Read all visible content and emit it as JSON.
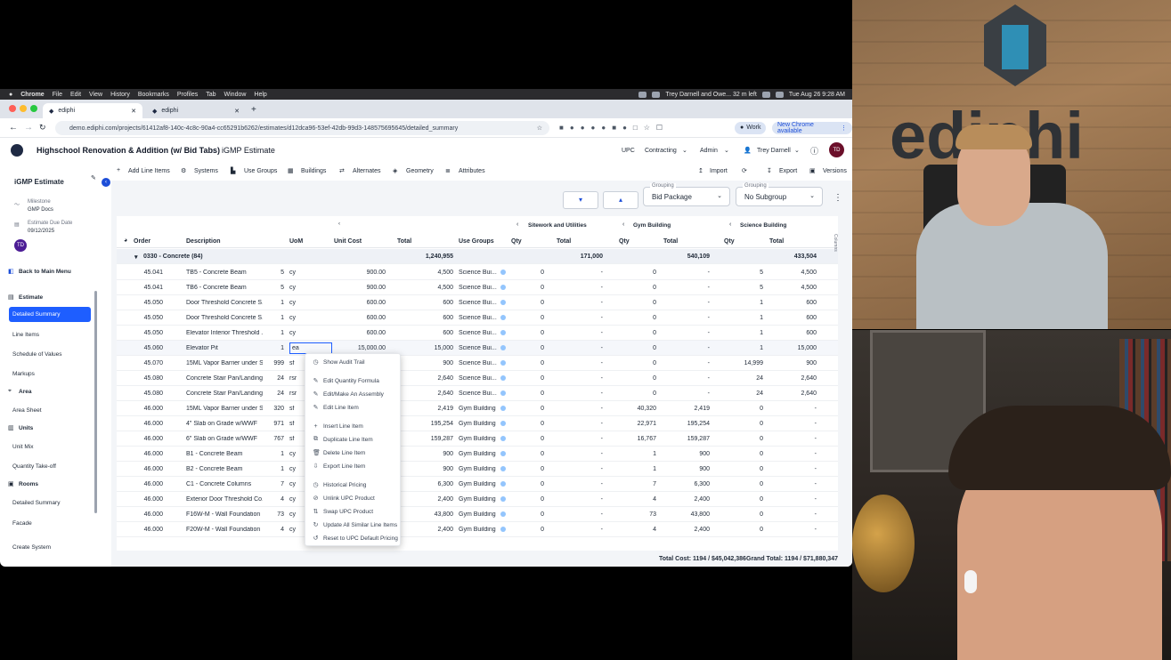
{
  "mac_menu": {
    "items": [
      "Chrome",
      "File",
      "Edit",
      "View",
      "History",
      "Bookmarks",
      "Profiles",
      "Tab",
      "Window",
      "Help"
    ],
    "meeting": "Trey Darnell and Owe... 32 m left",
    "datetime": "Tue Aug 26 9:28 AM"
  },
  "browser": {
    "tabs": [
      {
        "title": "ediphi"
      },
      {
        "title": "ediphi"
      }
    ],
    "url": "demo.ediphi.com/projects/61412af8-140c-4c8c-90a4-cc65291b6262/estimates/d12dca96-53ef-42db-99d3-148575695645/detailed_summary",
    "profile": "Work",
    "update_label": "New Chrome available"
  },
  "app": {
    "project": "Highschool Renovation & Addition (w/ Bid Tabs)",
    "estimate": "iGMP Estimate",
    "nav": [
      "UPC",
      "Contracting",
      "Admin",
      "Trey Darnell"
    ],
    "avatar": "TD"
  },
  "toolbar": {
    "left": [
      "Add Line Items",
      "Systems",
      "Use Groups",
      "Buildings",
      "Alternates",
      "Geometry",
      "Attributes"
    ],
    "right": [
      "Import",
      "Export",
      "Versions"
    ]
  },
  "sidebar": {
    "title": "iGMP Estimate",
    "milestone_label": "Milestone",
    "milestone_value": "GMP Docs",
    "due_label": "Estimate Due Date",
    "due_value": "09/12/2025",
    "avatar": "TD",
    "back": "Back to Main Menu",
    "sections": [
      {
        "header": "Estimate",
        "items": [
          "Detailed Summary",
          "Line Items",
          "Schedule of Values",
          "Markups"
        ]
      },
      {
        "header": "Area",
        "items": [
          "Area Sheet"
        ]
      },
      {
        "header": "Units",
        "items": [
          "Unit Mix",
          "Quantity Take-off"
        ]
      },
      {
        "header": "Rooms",
        "items": [
          "Detailed Summary",
          "Facade"
        ]
      }
    ],
    "create": "Create System"
  },
  "grouping": {
    "label1": "Grouping",
    "value1": "Bid Package",
    "label2": "Grouping",
    "value2": "No Subgroup"
  },
  "grid": {
    "group_headers": [
      "Sitework and Utilities",
      "Gym Building",
      "Science Building"
    ],
    "columns": [
      "Order",
      "Description",
      "UoM",
      "Unit Cost",
      "Total",
      "Use Groups",
      "Qty",
      "Total",
      "Qty",
      "Total",
      "Qty",
      "Total"
    ],
    "side_tab": "Columns",
    "group_row": {
      "label": "0330 - Concrete (84)",
      "total": "1,240,955",
      "t1": "171,000",
      "t2": "540,109",
      "t3": "433,504"
    },
    "rows": [
      {
        "order": "45.041",
        "desc": "TB5 - Concrete Beam",
        "qty": "5",
        "uom": "cy",
        "unit": "900.00",
        "total": "4,500",
        "use": "Science Bui...",
        "q1": "0",
        "t1": "-",
        "q2": "0",
        "t2": "-",
        "q3": "5",
        "t3": "4,500"
      },
      {
        "order": "45.041",
        "desc": "TB6 - Concrete Beam",
        "qty": "5",
        "uom": "cy",
        "unit": "900.00",
        "total": "4,500",
        "use": "Science Bui...",
        "q1": "0",
        "t1": "-",
        "q2": "0",
        "t2": "-",
        "q3": "5",
        "t3": "4,500"
      },
      {
        "order": "45.050",
        "desc": "Door Threshold Concrete S...",
        "qty": "1",
        "uom": "cy",
        "unit": "600.00",
        "total": "600",
        "use": "Science Bui...",
        "q1": "0",
        "t1": "-",
        "q2": "0",
        "t2": "-",
        "q3": "1",
        "t3": "600"
      },
      {
        "order": "45.050",
        "desc": "Door Threshold Concrete S...",
        "qty": "1",
        "uom": "cy",
        "unit": "600.00",
        "total": "600",
        "use": "Science Bui...",
        "q1": "0",
        "t1": "-",
        "q2": "0",
        "t2": "-",
        "q3": "1",
        "t3": "600"
      },
      {
        "order": "45.050",
        "desc": "Elevator Interior Threshold ...",
        "qty": "1",
        "uom": "cy",
        "unit": "600.00",
        "total": "600",
        "use": "Science Bui...",
        "q1": "0",
        "t1": "-",
        "q2": "0",
        "t2": "-",
        "q3": "1",
        "t3": "600"
      },
      {
        "order": "45.060",
        "desc": "Elevator Pit",
        "qty": "1",
        "uom": "ea",
        "unit": "15,000.00",
        "total": "15,000",
        "use": "Science Bui...",
        "q1": "0",
        "t1": "-",
        "q2": "0",
        "t2": "-",
        "q3": "1",
        "t3": "15,000"
      },
      {
        "order": "45.070",
        "desc": "15ML Vapor Barrier under S...",
        "qty": "999",
        "uom": "sf",
        "unit": "",
        "total": "900",
        "use": "Science Bui...",
        "q1": "0",
        "t1": "-",
        "q2": "0",
        "t2": "-",
        "q3": "14,999",
        "t3": "900"
      },
      {
        "order": "45.080",
        "desc": "Concrete Stair Pan/Landing...",
        "qty": "24",
        "uom": "rsr",
        "unit": "",
        "total": "2,640",
        "use": "Science Bui...",
        "q1": "0",
        "t1": "-",
        "q2": "0",
        "t2": "-",
        "q3": "24",
        "t3": "2,640"
      },
      {
        "order": "45.080",
        "desc": "Concrete Stair Pan/Landing...",
        "qty": "24",
        "uom": "rsr",
        "unit": "",
        "total": "2,640",
        "use": "Science Bui...",
        "q1": "0",
        "t1": "-",
        "q2": "0",
        "t2": "-",
        "q3": "24",
        "t3": "2,640"
      },
      {
        "order": "46.000",
        "desc": "15ML Vapor Barrier under S...",
        "qty": "320",
        "uom": "sf",
        "unit": "",
        "total": "2,419",
        "use": "Gym Building",
        "q1": "0",
        "t1": "-",
        "q2": "40,320",
        "t2": "2,419",
        "q3": "0",
        "t3": "-"
      },
      {
        "order": "46.000",
        "desc": "4\" Slab on Grade w/WWF",
        "qty": "971",
        "uom": "sf",
        "unit": "",
        "total": "195,254",
        "use": "Gym Building",
        "q1": "0",
        "t1": "-",
        "q2": "22,971",
        "t2": "195,254",
        "q3": "0",
        "t3": "-"
      },
      {
        "order": "46.000",
        "desc": "6\" Slab on Grade w/WWF",
        "qty": "767",
        "uom": "sf",
        "unit": "",
        "total": "159,287",
        "use": "Gym Building",
        "q1": "0",
        "t1": "-",
        "q2": "16,767",
        "t2": "159,287",
        "q3": "0",
        "t3": "-"
      },
      {
        "order": "46.000",
        "desc": "B1 - Concrete Beam",
        "qty": "1",
        "uom": "cy",
        "unit": "",
        "total": "900",
        "use": "Gym Building",
        "q1": "0",
        "t1": "-",
        "q2": "1",
        "t2": "900",
        "q3": "0",
        "t3": "-"
      },
      {
        "order": "46.000",
        "desc": "B2 - Concrete Beam",
        "qty": "1",
        "uom": "cy",
        "unit": "",
        "total": "900",
        "use": "Gym Building",
        "q1": "0",
        "t1": "-",
        "q2": "1",
        "t2": "900",
        "q3": "0",
        "t3": "-"
      },
      {
        "order": "46.000",
        "desc": "C1 - Concrete Columns",
        "qty": "7",
        "uom": "cy",
        "unit": "",
        "total": "6,300",
        "use": "Gym Building",
        "q1": "0",
        "t1": "-",
        "q2": "7",
        "t2": "6,300",
        "q3": "0",
        "t3": "-"
      },
      {
        "order": "46.000",
        "desc": "Exterior Door Threshold Co...",
        "qty": "4",
        "uom": "cy",
        "unit": "",
        "total": "2,400",
        "use": "Gym Building",
        "q1": "0",
        "t1": "-",
        "q2": "4",
        "t2": "2,400",
        "q3": "0",
        "t3": "-"
      },
      {
        "order": "46.000",
        "desc": "F16W-M - Wall Foundation",
        "qty": "73",
        "uom": "cy",
        "unit": "",
        "total": "43,800",
        "use": "Gym Building",
        "q1": "0",
        "t1": "-",
        "q2": "73",
        "t2": "43,800",
        "q3": "0",
        "t3": "-"
      },
      {
        "order": "46.000",
        "desc": "F20W-M - Wall Foundation",
        "qty": "4",
        "uom": "cy",
        "unit": "",
        "total": "2,400",
        "use": "Gym Building",
        "q1": "0",
        "t1": "-",
        "q2": "4",
        "t2": "2,400",
        "q3": "0",
        "t3": "-"
      }
    ]
  },
  "context_menu": [
    {
      "label": "Show Audit Trail",
      "icon": "history-icon"
    },
    {
      "label": "Edit Quantity Formula",
      "icon": "pencil-icon"
    },
    {
      "label": "Edit/Make An Assembly",
      "icon": "pencil-icon"
    },
    {
      "label": "Edit Line Item",
      "icon": "pencil-icon"
    },
    {
      "label": "Insert Line Item",
      "icon": "plus-icon"
    },
    {
      "label": "Duplicate Line Item",
      "icon": "copy-icon"
    },
    {
      "label": "Delete Line Item",
      "icon": "trash-icon"
    },
    {
      "label": "Export Line Item",
      "icon": "export-icon"
    },
    {
      "label": "Historical Pricing",
      "icon": "history-icon"
    },
    {
      "label": "Unlink UPC Product",
      "icon": "unlink-icon"
    },
    {
      "label": "Swap UPC Product",
      "icon": "swap-icon"
    },
    {
      "label": "Update All Similar Line Items",
      "icon": "refresh-icon"
    },
    {
      "label": "Reset to UPC Default Pricing",
      "icon": "reset-icon"
    }
  ],
  "footer": {
    "total_cost": "Total Cost: 1194 / $45,042,386",
    "grand_total": "Grand Total: 1194 / $71,880,347"
  },
  "video": {
    "logo": "ediphi"
  },
  "colors": {
    "accent": "#1d4ed8",
    "selected": "#1e5eff",
    "brand": "#1f2a44"
  }
}
